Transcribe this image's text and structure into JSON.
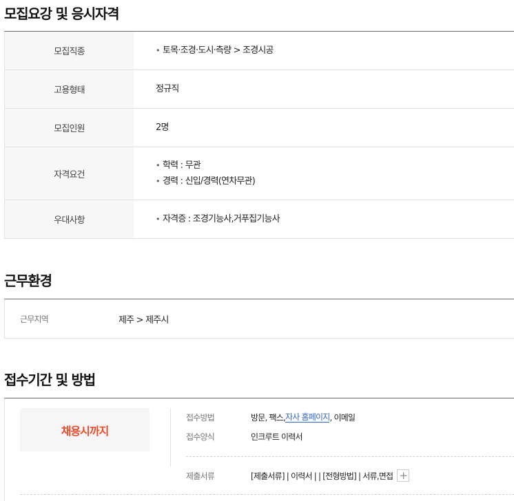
{
  "requirements": {
    "title": "모집요강 및 응시자격",
    "rows": [
      {
        "label": "모집직종",
        "items": [
          "토목·조경·도시·측량 > 조경시공"
        ],
        "bulleted": true
      },
      {
        "label": "고용형태",
        "items": [
          "정규직"
        ],
        "bulleted": false
      },
      {
        "label": "모집인원",
        "items": [
          "2명"
        ],
        "bulleted": false
      },
      {
        "label": "자격요건",
        "items": [
          "학력 : 무관",
          "경력 : 신입/경력(연차무관)"
        ],
        "bulleted": true
      },
      {
        "label": "우대사항",
        "items": [
          "자격증 : 조경기능사,거푸집기능사"
        ],
        "bulleted": true
      }
    ]
  },
  "environment": {
    "title": "근무환경",
    "label": "근무지역",
    "value": "제주 > 제주시"
  },
  "application": {
    "title": "접수기간 및 방법",
    "deadline": "채용시까지",
    "method_label": "접수방법",
    "method_prefix": "방문, 팩스, ",
    "method_link": "자사 홈페이지",
    "method_suffix": ", 이메일",
    "form_label": "접수양식",
    "form_value": "인크루트 이력서",
    "docs_label": "제출서류",
    "docs_value": "[제출서류] | 이력서 | | [전형방법] | 서류,면접",
    "plus_symbol": "+"
  },
  "icons": {
    "bullet": "bullet-dot-icon",
    "expand": "plus-icon"
  },
  "colors": {
    "accent": "#ee4b2b",
    "link": "#3366cc"
  }
}
